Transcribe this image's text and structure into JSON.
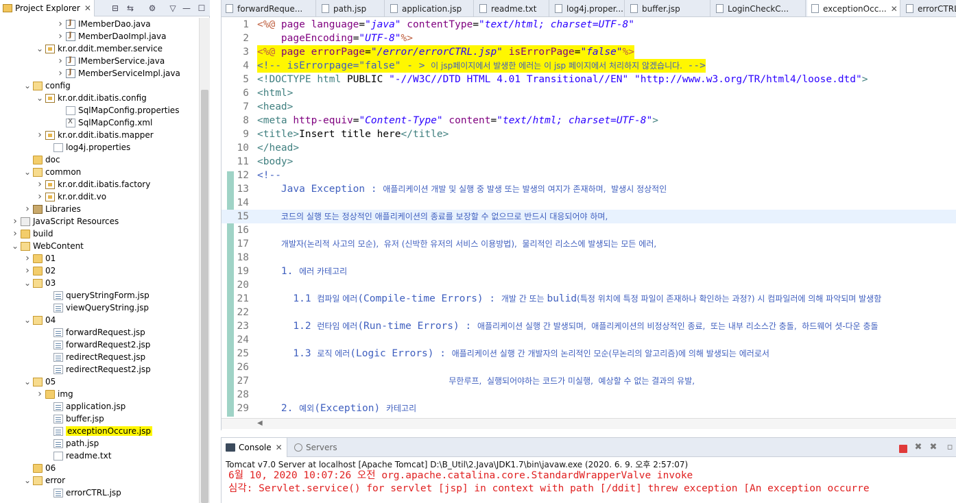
{
  "explorer": {
    "title": "Project Explorer",
    "close": "✕",
    "tree": [
      {
        "label": "IMemberDao.java",
        "icon": "java-file-icon",
        "indent": 94,
        "arrow": "collapsed",
        "kind": "java"
      },
      {
        "label": "MemberDaoImpl.java",
        "icon": "java-file-icon",
        "indent": 94,
        "arrow": "collapsed",
        "kind": "java"
      },
      {
        "label": "kr.or.ddit.member.service",
        "icon": "package-icon",
        "indent": 64,
        "arrow": "expanded",
        "kind": "package"
      },
      {
        "label": "IMemberService.java",
        "icon": "java-file-icon",
        "indent": 94,
        "arrow": "collapsed",
        "kind": "java"
      },
      {
        "label": "MemberServiceImpl.java",
        "icon": "java-file-icon",
        "indent": 94,
        "arrow": "collapsed",
        "kind": "java"
      },
      {
        "label": "config",
        "icon": "folder-icon",
        "indent": 46,
        "arrow": "expanded",
        "kind": "openfolder"
      },
      {
        "label": "kr.or.ddit.ibatis.config",
        "icon": "package-icon",
        "indent": 64,
        "arrow": "expanded",
        "kind": "package"
      },
      {
        "label": "SqlMapConfig.properties",
        "icon": "properties-file-icon",
        "indent": 94,
        "arrow": "none",
        "kind": "file"
      },
      {
        "label": "SqlMapConfig.xml",
        "icon": "xml-file-icon",
        "indent": 94,
        "arrow": "none",
        "kind": "xml"
      },
      {
        "label": "kr.or.ddit.ibatis.mapper",
        "icon": "package-icon",
        "indent": 64,
        "arrow": "collapsed",
        "kind": "package"
      },
      {
        "label": "log4j.properties",
        "icon": "properties-file-icon",
        "indent": 76,
        "arrow": "none",
        "kind": "file"
      },
      {
        "label": "doc",
        "icon": "folder-icon",
        "indent": 46,
        "arrow": "none",
        "kind": "folder"
      },
      {
        "label": "common",
        "icon": "folder-icon",
        "indent": 46,
        "arrow": "expanded",
        "kind": "openfolder"
      },
      {
        "label": "kr.or.ddit.ibatis.factory",
        "icon": "package-icon",
        "indent": 64,
        "arrow": "collapsed",
        "kind": "package"
      },
      {
        "label": "kr.or.ddit.vo",
        "icon": "package-icon",
        "indent": 64,
        "arrow": "collapsed",
        "kind": "package"
      },
      {
        "label": "Libraries",
        "icon": "library-icon",
        "indent": 46,
        "arrow": "collapsed",
        "kind": "lib"
      },
      {
        "label": "JavaScript Resources",
        "icon": "javascript-resources-icon",
        "indent": 28,
        "arrow": "collapsed",
        "kind": "js"
      },
      {
        "label": "build",
        "icon": "folder-icon",
        "indent": 28,
        "arrow": "collapsed",
        "kind": "folder"
      },
      {
        "label": "WebContent",
        "icon": "folder-icon",
        "indent": 28,
        "arrow": "expanded",
        "kind": "openfolder"
      },
      {
        "label": "01",
        "icon": "folder-icon",
        "indent": 46,
        "arrow": "collapsed",
        "kind": "folder"
      },
      {
        "label": "02",
        "icon": "folder-icon",
        "indent": 46,
        "arrow": "collapsed",
        "kind": "folder"
      },
      {
        "label": "03",
        "icon": "folder-icon",
        "indent": 46,
        "arrow": "expanded",
        "kind": "openfolder"
      },
      {
        "label": "queryStringForm.jsp",
        "icon": "jsp-file-icon",
        "indent": 76,
        "arrow": "none",
        "kind": "jsp"
      },
      {
        "label": "viewQueryString.jsp",
        "icon": "jsp-file-icon",
        "indent": 76,
        "arrow": "none",
        "kind": "jsp"
      },
      {
        "label": "04",
        "icon": "folder-icon",
        "indent": 46,
        "arrow": "expanded",
        "kind": "openfolder"
      },
      {
        "label": "forwardRequest.jsp",
        "icon": "jsp-file-icon",
        "indent": 76,
        "arrow": "none",
        "kind": "jsp"
      },
      {
        "label": "forwardRequest2.jsp",
        "icon": "jsp-file-icon",
        "indent": 76,
        "arrow": "none",
        "kind": "jsp"
      },
      {
        "label": "redirectRequest.jsp",
        "icon": "jsp-file-icon",
        "indent": 76,
        "arrow": "none",
        "kind": "jsp"
      },
      {
        "label": "redirectRequest2.jsp",
        "icon": "jsp-file-icon",
        "indent": 76,
        "arrow": "none",
        "kind": "jsp"
      },
      {
        "label": "05",
        "icon": "folder-icon",
        "indent": 46,
        "arrow": "expanded",
        "kind": "openfolder"
      },
      {
        "label": "img",
        "icon": "folder-icon",
        "indent": 64,
        "arrow": "collapsed",
        "kind": "folder"
      },
      {
        "label": "application.jsp",
        "icon": "jsp-file-icon",
        "indent": 76,
        "arrow": "none",
        "kind": "jsp"
      },
      {
        "label": "buffer.jsp",
        "icon": "jsp-file-icon",
        "indent": 76,
        "arrow": "none",
        "kind": "jsp"
      },
      {
        "label": "exceptionOccure.jsp",
        "icon": "jsp-file-icon",
        "indent": 76,
        "arrow": "none",
        "kind": "jsp",
        "highlight": true
      },
      {
        "label": "path.jsp",
        "icon": "jsp-file-icon",
        "indent": 76,
        "arrow": "none",
        "kind": "jsp"
      },
      {
        "label": "readme.txt",
        "icon": "text-file-icon",
        "indent": 76,
        "arrow": "none",
        "kind": "file"
      },
      {
        "label": "06",
        "icon": "folder-icon",
        "indent": 46,
        "arrow": "none",
        "kind": "folder"
      },
      {
        "label": "error",
        "icon": "folder-icon",
        "indent": 46,
        "arrow": "expanded",
        "kind": "openfolder"
      },
      {
        "label": "errorCTRL.jsp",
        "icon": "jsp-file-icon",
        "indent": 76,
        "arrow": "none",
        "kind": "jsp"
      }
    ]
  },
  "editor": {
    "tabs": [
      {
        "label": "forwardReque...",
        "active": false
      },
      {
        "label": "path.jsp",
        "active": false
      },
      {
        "label": "application.jsp",
        "active": false
      },
      {
        "label": "readme.txt",
        "active": false
      },
      {
        "label": "log4j.proper...",
        "active": false
      },
      {
        "label": "buffer.jsp",
        "active": false
      },
      {
        "label": "LoginCheckC...",
        "active": false
      },
      {
        "label": "exceptionOcc...",
        "active": true,
        "close": "✕"
      },
      {
        "label": "errorCTRL",
        "active": false
      }
    ],
    "lines": [
      {
        "n": "1",
        "parts": [
          [
            "dir",
            "<%@ "
          ],
          [
            "attr",
            "page "
          ],
          [
            "attr",
            "language"
          ],
          [
            "plain",
            "="
          ],
          [
            "val",
            "\"java\""
          ],
          [
            "plain",
            " "
          ],
          [
            "attr",
            "contentType"
          ],
          [
            "plain",
            "="
          ],
          [
            "val",
            "\"text/html; charset=UTF-8\""
          ]
        ]
      },
      {
        "n": "2",
        "parts": [
          [
            "plain",
            "    "
          ],
          [
            "attr",
            "pageEncoding"
          ],
          [
            "plain",
            "="
          ],
          [
            "val",
            "\"UTF-8\""
          ],
          [
            "dir",
            "%>"
          ]
        ]
      },
      {
        "n": "3",
        "highlight": true,
        "parts": [
          [
            "dir",
            "<%@ "
          ],
          [
            "attr",
            "page "
          ],
          [
            "attr",
            "errorPage"
          ],
          [
            "plain",
            "="
          ],
          [
            "val",
            "\"/error/errorCTRL.jsp\""
          ],
          [
            "plain",
            " "
          ],
          [
            "attr",
            "isErrorPage"
          ],
          [
            "plain",
            "="
          ],
          [
            "val",
            "\"false\""
          ],
          [
            "dir",
            "%>"
          ]
        ]
      },
      {
        "n": "4",
        "highlight": true,
        "parts": [
          [
            "cmt",
            "<!-- isErrorpage=\"false\" - > "
          ],
          [
            "cmtkr",
            "이 jsp페이지에서 발생한 에러는 이 jsp 페이지에서 처리하지 않겠습니다.  "
          ],
          [
            "cmt",
            "-->"
          ]
        ]
      },
      {
        "n": "5",
        "parts": [
          [
            "tag",
            "<!DOCTYPE "
          ],
          [
            "tag",
            "html "
          ],
          [
            "plain",
            "PUBLIC "
          ],
          [
            "val2",
            "\"-//W3C//DTD HTML 4.01 Transitional//EN\""
          ],
          [
            "plain",
            " "
          ],
          [
            "val2",
            "\"http://www.w3.org/TR/html4/loose.dtd\""
          ],
          [
            "tag",
            ">"
          ]
        ]
      },
      {
        "n": "6",
        "parts": [
          [
            "tag",
            "<html>"
          ]
        ]
      },
      {
        "n": "7",
        "parts": [
          [
            "tag",
            "<head>"
          ]
        ]
      },
      {
        "n": "8",
        "parts": [
          [
            "tag",
            "<meta "
          ],
          [
            "attr",
            "http-equiv"
          ],
          [
            "plain",
            "="
          ],
          [
            "val",
            "\"Content-Type\""
          ],
          [
            "plain",
            " "
          ],
          [
            "attr",
            "content"
          ],
          [
            "plain",
            "="
          ],
          [
            "val",
            "\"text/html; charset=UTF-8\""
          ],
          [
            "tag",
            ">"
          ]
        ]
      },
      {
        "n": "9",
        "parts": [
          [
            "tag",
            "<title>"
          ],
          [
            "plain",
            "Insert title here"
          ],
          [
            "tag",
            "</title>"
          ]
        ]
      },
      {
        "n": "10",
        "parts": [
          [
            "tag",
            "</head>"
          ]
        ]
      },
      {
        "n": "11",
        "parts": [
          [
            "tag",
            "<body>"
          ]
        ]
      },
      {
        "n": "12",
        "parts": [
          [
            "cmt",
            "<!--"
          ]
        ]
      },
      {
        "n": "13",
        "parts": [
          [
            "cmt",
            "    Java Exception : "
          ],
          [
            "cmtkr",
            "애플리케이션 개발 및 실행 중 발생 또는 발생의 여지가 존재하며,  발생시 정상적인"
          ]
        ]
      },
      {
        "n": "14",
        "parts": []
      },
      {
        "n": "15",
        "current": true,
        "parts": [
          [
            "cmt",
            "    "
          ],
          [
            "cmtkr",
            "코드의 실행 또는 정상적인 애플리케이션의 종료를 보장할 수 없으므로 반드시 대응되어야 하며,"
          ]
        ]
      },
      {
        "n": "16",
        "parts": []
      },
      {
        "n": "17",
        "parts": [
          [
            "cmt",
            "    "
          ],
          [
            "cmtkr",
            "개발자(논리적 사고의 모순),  유저 (신박한 유저의 서비스 이용방법),  물리적인 리소스에 발생되는 모든 에러,"
          ]
        ]
      },
      {
        "n": "18",
        "parts": []
      },
      {
        "n": "19",
        "parts": [
          [
            "cmt",
            "    1. "
          ],
          [
            "cmtkr",
            "에러 카테고리"
          ]
        ]
      },
      {
        "n": "20",
        "parts": []
      },
      {
        "n": "21",
        "parts": [
          [
            "cmt",
            "      1.1 "
          ],
          [
            "cmtkr",
            "컴파일 에러"
          ],
          [
            "cmt",
            "(Compile-time Errors) : "
          ],
          [
            "cmtkr",
            "개발 간 또는 "
          ],
          [
            "cmt",
            "bulid"
          ],
          [
            "cmtkr",
            "(특정 위치에 특정 파일이 존재하나 확인하는 과정?) 시 컴파일러에 의해 파악되며 발생함"
          ]
        ]
      },
      {
        "n": "22",
        "parts": []
      },
      {
        "n": "23",
        "parts": [
          [
            "cmt",
            "      1.2 "
          ],
          [
            "cmtkr",
            "런타임 에러"
          ],
          [
            "cmt",
            "(Run-time Errors) : "
          ],
          [
            "cmtkr",
            "애플리케이션 실행 간 발생되며,  애플리케이션의 비정상적인 종료,  또는 내부 리소스간 충돌,  하드웨어 셧-다운 충돌"
          ]
        ]
      },
      {
        "n": "24",
        "parts": []
      },
      {
        "n": "25",
        "parts": [
          [
            "cmt",
            "      1.3 "
          ],
          [
            "cmtkr",
            "로직 에러"
          ],
          [
            "cmt",
            "(Logic Errors) : "
          ],
          [
            "cmtkr",
            "애플리케이션 실행 간 개발자의 논리적인 모순(무논리의 알고리즘)에 의해 발생되는 에러로서"
          ]
        ]
      },
      {
        "n": "26",
        "parts": []
      },
      {
        "n": "27",
        "parts": [
          [
            "cmt",
            "                                "
          ],
          [
            "cmtkr",
            "무한루프,  실행되어야하는 코드가 미실행,  예상할 수 없는 결과의 유발,"
          ]
        ]
      },
      {
        "n": "28",
        "parts": []
      },
      {
        "n": "29",
        "parts": [
          [
            "cmt",
            "    2. "
          ],
          [
            "cmtkr",
            "예외"
          ],
          [
            "cmt",
            "(Exception) "
          ],
          [
            "cmtkr",
            "카테고리"
          ]
        ]
      }
    ]
  },
  "console": {
    "tab_console": "Console",
    "tab_console_close": "✕",
    "tab_servers": "Servers",
    "description": "Tomcat v7.0 Server at localhost [Apache Tomcat] D:\\B_Util\\2.Java\\JDK1.7\\bin\\javaw.exe (2020. 6. 9. 오후 2:57:07)",
    "lines": [
      "6월 10, 2020 10:07:26 오전 org.apache.catalina.core.StandardWrapperValve invoke",
      "심각: Servlet.service() for servlet [jsp] in context with path [/ddit] threw exception [An exception occurre"
    ]
  },
  "colors": {
    "highlight": "#fff700",
    "error_text": "#e02020",
    "gutter_marker": "#9fd3c6"
  }
}
